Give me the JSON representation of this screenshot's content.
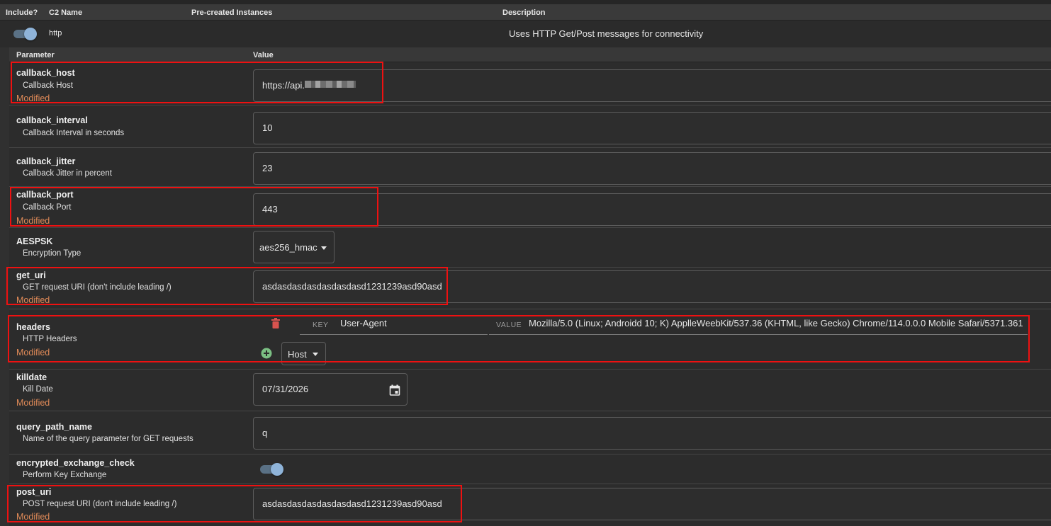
{
  "table_header": {
    "include": "Include?",
    "c2_name": "C2 Name",
    "instances": "Pre-created Instances",
    "description": "Description"
  },
  "c2_profile": {
    "name": "http",
    "description": "Uses HTTP Get/Post messages for connectivity",
    "included": true
  },
  "param_header": {
    "parameter": "Parameter",
    "value": "Value"
  },
  "modified_label": "Modified",
  "params": {
    "callback_host": {
      "name": "callback_host",
      "desc": "Callback Host",
      "value": "https://api.",
      "modified": true
    },
    "callback_interval": {
      "name": "callback_interval",
      "desc": "Callback Interval in seconds",
      "value": "10"
    },
    "callback_jitter": {
      "name": "callback_jitter",
      "desc": "Callback Jitter in percent",
      "value": "23"
    },
    "callback_port": {
      "name": "callback_port",
      "desc": "Callback Port",
      "value": "443",
      "modified": true
    },
    "aespsk": {
      "name": "AESPSK",
      "desc": "Encryption Type",
      "value": "aes256_hmac"
    },
    "get_uri": {
      "name": "get_uri",
      "desc": "GET request URI (don't include leading /)",
      "value": "asdasdasdasdasdasdasd1231239asd90asd",
      "modified": true
    },
    "headers": {
      "name": "headers",
      "desc": "HTTP Headers",
      "modified": true,
      "key_label": "KEY",
      "value_label": "VALUE",
      "key": "User-Agent",
      "value": "Mozilla/5.0 (Linux; Androidd 10; K) ApplleWeebKit/537.36 (KHTML, like Gecko) Chrome/114.0.0.0 Mobile Safari/5371.361",
      "add_select": "Host"
    },
    "killdate": {
      "name": "killdate",
      "desc": "Kill Date",
      "value": "07/31/2026",
      "modified": true
    },
    "query_path_name": {
      "name": "query_path_name",
      "desc": "Name of the query parameter for GET requests",
      "value": "q"
    },
    "encrypted_exchange_check": {
      "name": "encrypted_exchange_check",
      "desc": "Perform Key Exchange",
      "enabled": true
    },
    "post_uri": {
      "name": "post_uri",
      "desc": "POST request URI (don't include leading /)",
      "value": "asdasdasdasdasdasdasd1231239asd90asd",
      "modified": true
    }
  },
  "colors": {
    "highlight_box": "#ee1111",
    "modified_text": "#e08a58",
    "toggle_on": "#8fb4d9",
    "delete_icon": "#d9534f",
    "add_icon": "#7bbf83"
  },
  "icons": {
    "delete": "trash-icon",
    "add": "plus-circle-icon",
    "calendar": "calendar-icon",
    "dropdown": "chevron-down-icon"
  }
}
